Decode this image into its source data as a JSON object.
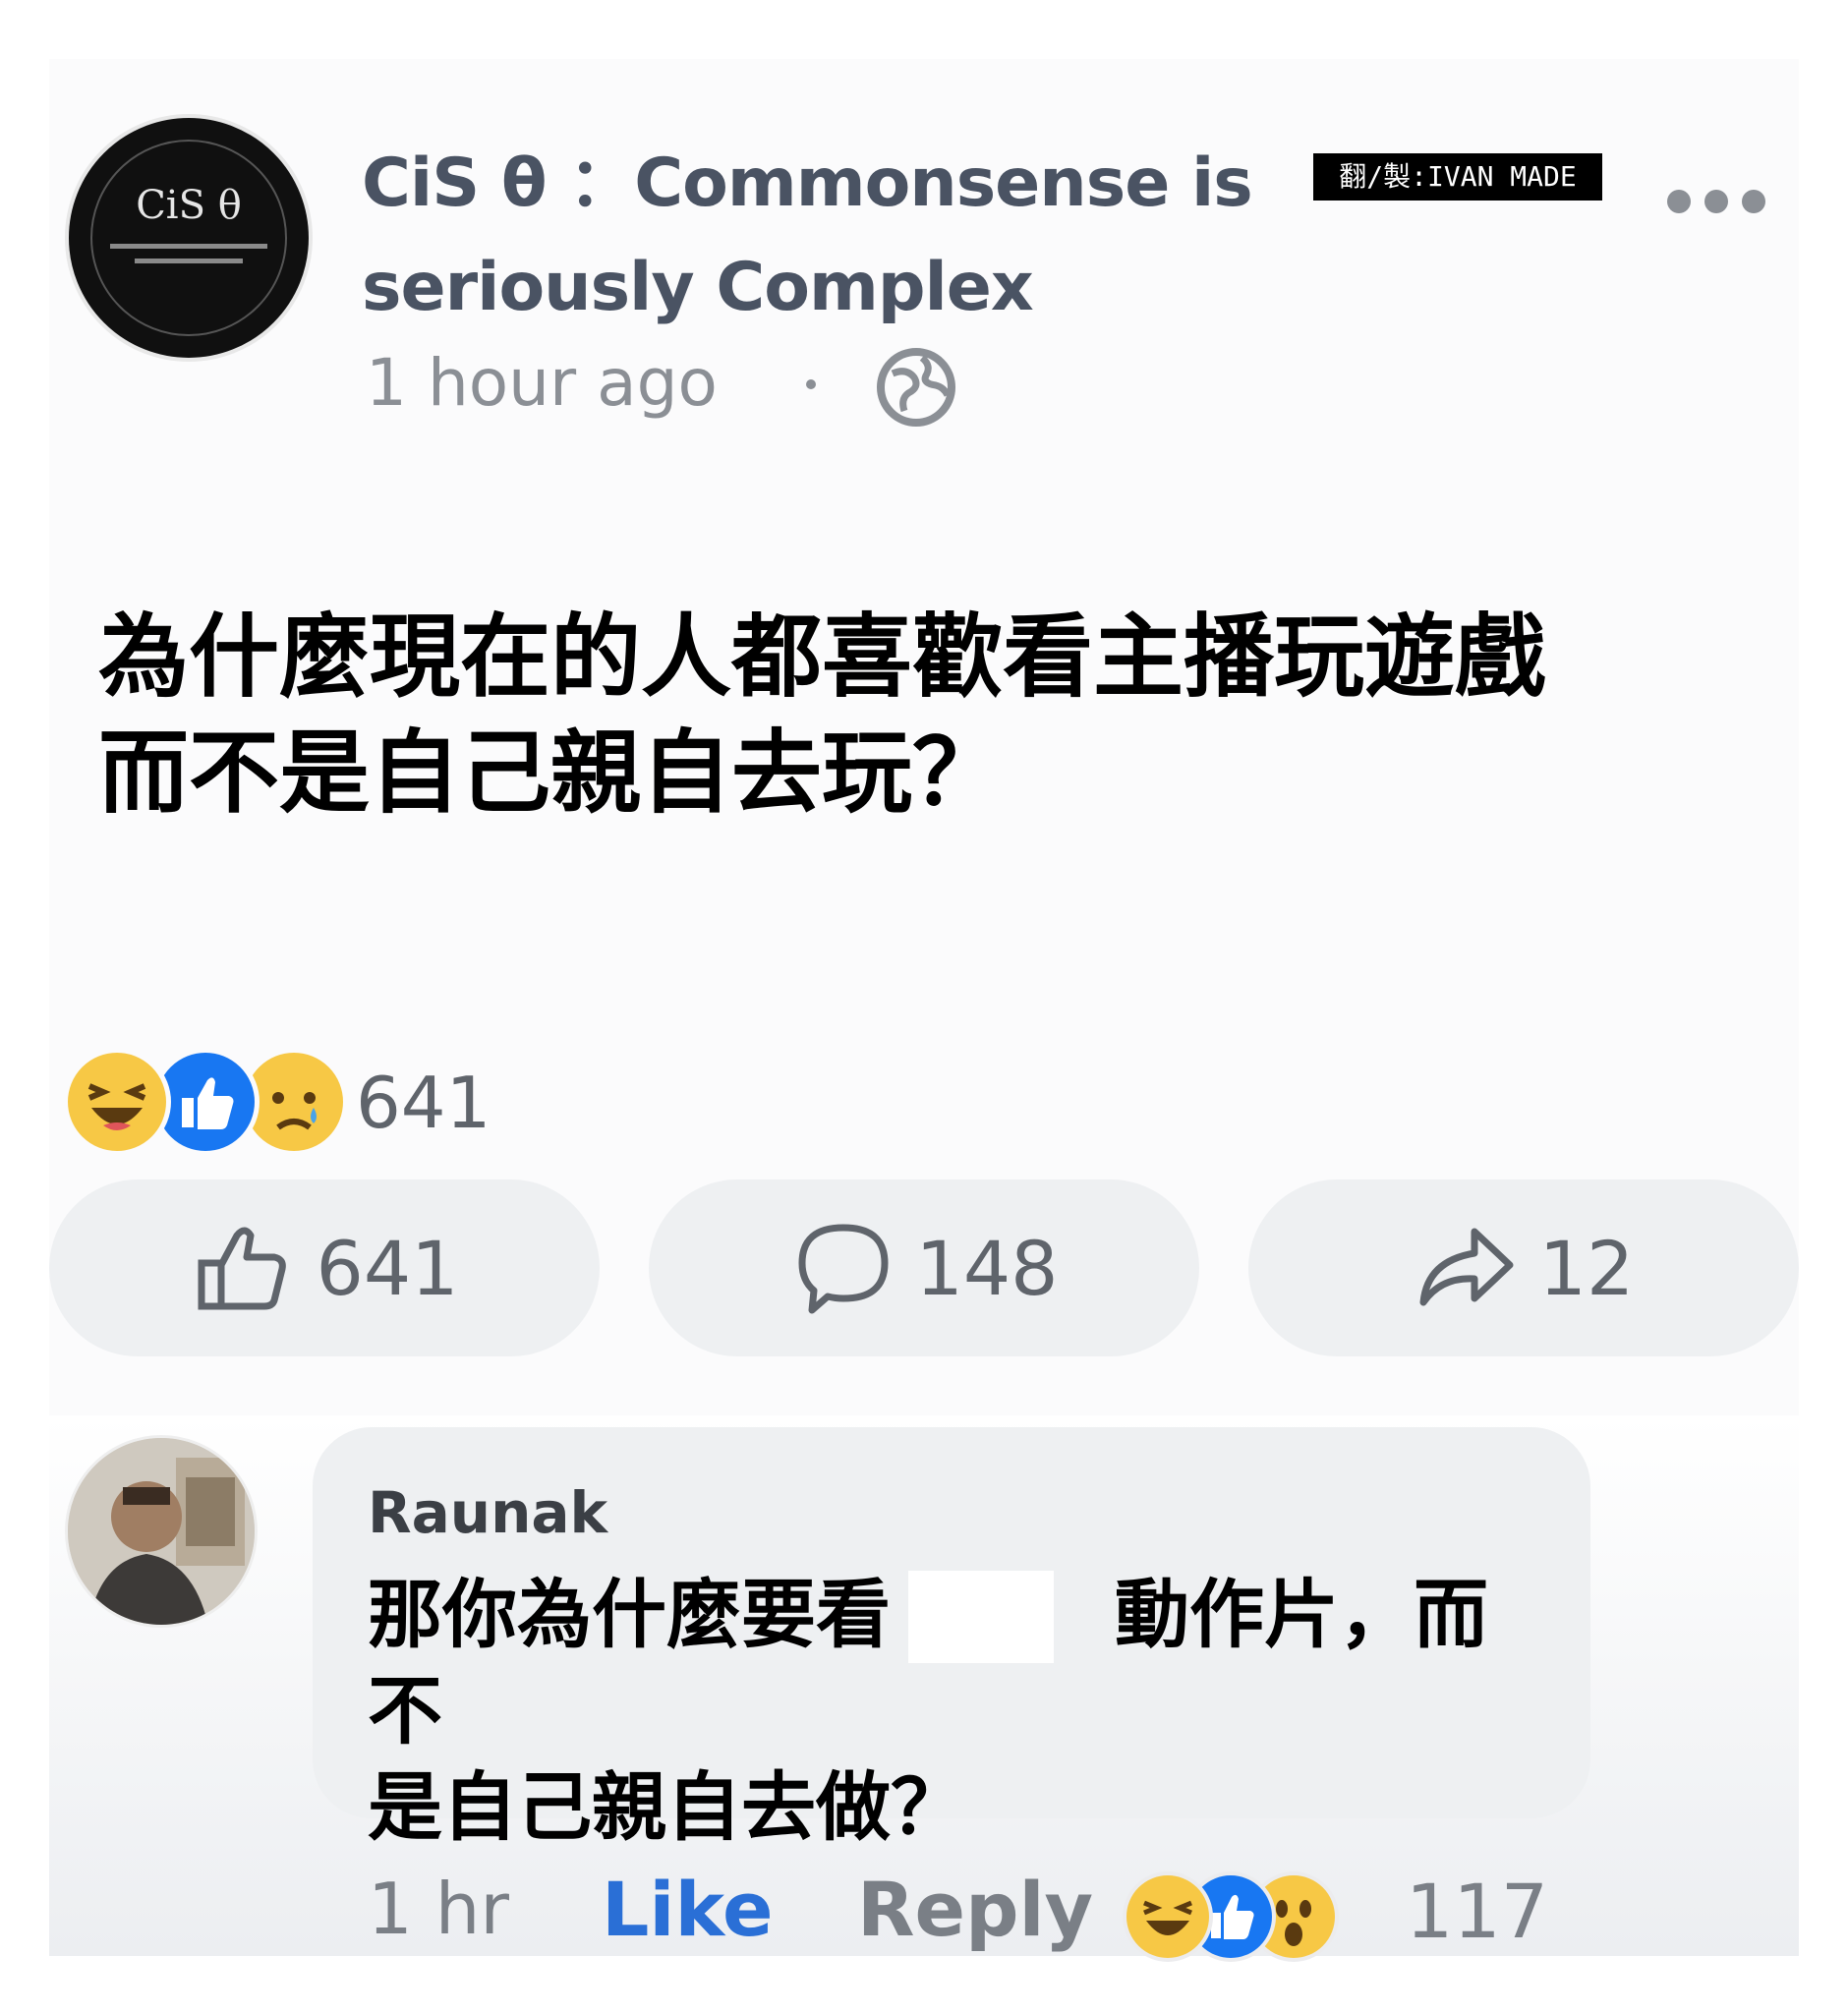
{
  "page": {
    "name_line1": "CiS θ ：Commonsense is",
    "name_line2": "seriously Complex",
    "logo_text": "CiS θ",
    "time": "1 hour ago"
  },
  "watermark": "翻/製:IVAN MADE",
  "post": {
    "text": "為什麼現在的人都喜歡看主播玩遊戲\n而不是自己親自去玩？"
  },
  "reactions": {
    "icons": [
      "haha-icon",
      "like-icon",
      "sad-icon"
    ],
    "count": "641"
  },
  "actions": {
    "like_count": "641",
    "comment_count": "148",
    "share_count": "12"
  },
  "comment": {
    "author": "Raunak",
    "text": "那你為什麼要看　　　動作片，而不\n是自己親自去做？",
    "time": "1 hr",
    "like_label": "Like",
    "reply_label": "Reply",
    "reaction_icons": [
      "haha-icon",
      "like-icon",
      "wow-icon"
    ],
    "reaction_count": "117"
  },
  "colors": {
    "link_blue": "#2a6fd6",
    "facebook_blue": "#1877f2",
    "reaction_yellow": "#f7c845",
    "muted_gray": "#7a7f86"
  }
}
